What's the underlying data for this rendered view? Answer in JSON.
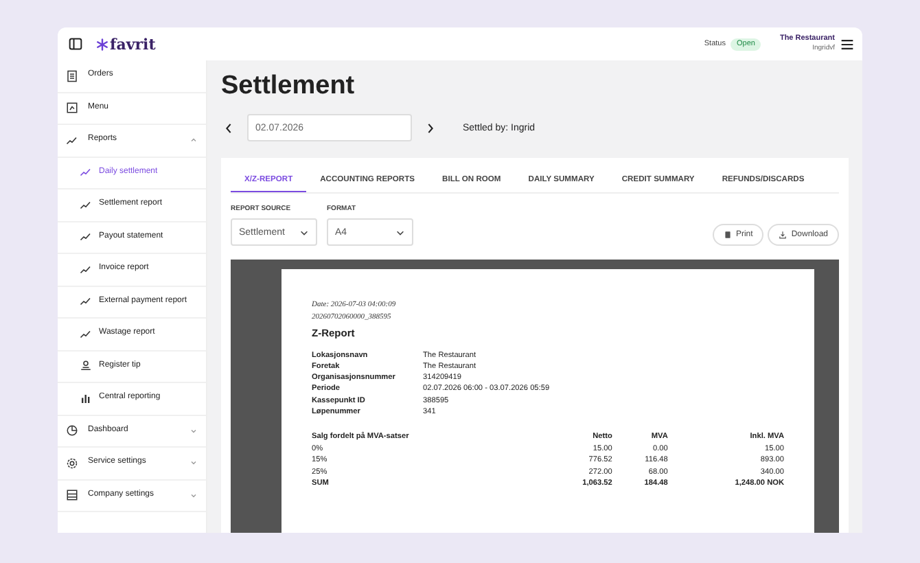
{
  "header": {
    "logo": "favrit",
    "status_label": "Status",
    "status": "Open",
    "restaurant": "The Restaurant",
    "user": "Ingridvf"
  },
  "sidebar": {
    "items": [
      {
        "label": "Orders",
        "selected": false
      },
      {
        "label": "Menu",
        "selected": false
      },
      {
        "label": "Reports",
        "selected": false,
        "expanded": true,
        "children": [
          {
            "label": "Daily settlement",
            "selected": true
          },
          {
            "label": "Settlement report",
            "selected": false
          },
          {
            "label": "Payout statement",
            "selected": false
          },
          {
            "label": "Invoice report",
            "selected": false
          },
          {
            "label": "External payment report",
            "selected": false
          },
          {
            "label": "Wastage report",
            "selected": false
          },
          {
            "label": "Register tip",
            "selected": false
          },
          {
            "label": "Central reporting",
            "selected": false
          }
        ]
      },
      {
        "label": "Dashboard",
        "selected": false,
        "expanded": false
      },
      {
        "label": "Service settings",
        "selected": false,
        "expanded": false
      },
      {
        "label": "Company settings",
        "selected": false,
        "expanded": false
      }
    ]
  },
  "page": {
    "title": "Settlement",
    "date": "02.07.2026",
    "settled_by": "Settled by: Ingrid"
  },
  "tabs": [
    {
      "label": "X/Z-REPORT",
      "selected": true
    },
    {
      "label": "ACCOUNTING REPORTS",
      "selected": false
    },
    {
      "label": "BILL ON ROOM",
      "selected": false
    },
    {
      "label": "DAILY SUMMARY",
      "selected": false
    },
    {
      "label": "CREDIT SUMMARY",
      "selected": false
    },
    {
      "label": "REFUNDS/DISCARDS",
      "selected": false
    }
  ],
  "filters": [
    {
      "label": "REPORT SOURCE",
      "value": "Settlement"
    },
    {
      "label": "FORMAT",
      "value": "A4"
    }
  ],
  "actions": [
    {
      "label": "Print"
    },
    {
      "label": "Download"
    }
  ],
  "report": {
    "date_line": "Date: 2026-07-03 04:00:09",
    "id_line": "20260702060000_388595",
    "title": "Z-Report",
    "fields": [
      {
        "label": "Lokasjonsnavn",
        "value": "The Restaurant"
      },
      {
        "label": "Foretak",
        "value": "The Restaurant"
      },
      {
        "label": "Organisasjonsnummer",
        "value": "314209419"
      },
      {
        "label": "Periode",
        "value": "02.07.2026 06:00 - 03.07.2026 05:59"
      },
      {
        "label": "Kassepunkt ID",
        "value": "388595"
      },
      {
        "label": "Løpenummer",
        "value": "341"
      }
    ],
    "vat_table": {
      "columns": [
        "Salg fordelt på MVA-satser",
        "Netto",
        "MVA",
        "Inkl. MVA"
      ],
      "rows": [
        {
          "cells": [
            "0%",
            "15.00",
            "0.00",
            "15.00"
          ],
          "total": false
        },
        {
          "cells": [
            "15%",
            "776.52",
            "116.48",
            "893.00"
          ],
          "total": false
        },
        {
          "cells": [
            "25%",
            "272.00",
            "68.00",
            "340.00"
          ],
          "total": false
        },
        {
          "cells": [
            "SUM",
            "1,063.52",
            "184.48",
            "1,248.00 NOK"
          ],
          "total": true
        }
      ]
    }
  }
}
